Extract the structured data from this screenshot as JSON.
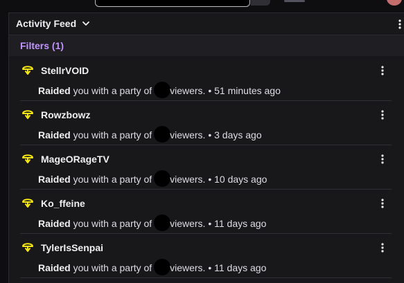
{
  "panel": {
    "title": "Activity Feed",
    "filters_label": "Filters (1)"
  },
  "colors": {
    "accent": "#bf94ff",
    "raid_icon": "#f5e614",
    "background": "#18181b"
  },
  "feed": {
    "items": [
      {
        "name": "StellrVOID",
        "action": "Raided",
        "text_before": " you with a party of ",
        "text_after": "viewers.",
        "time": " • 51 minutes ago"
      },
      {
        "name": "Rowzbowz",
        "action": "Raided",
        "text_before": " you with a party of ",
        "text_after": "viewers.",
        "time": " • 3 days ago"
      },
      {
        "name": "MageORageTV",
        "action": "Raided",
        "text_before": " you with a party of ",
        "text_after": "viewers.",
        "time": " • 10 days ago"
      },
      {
        "name": "Ko_ffeine",
        "action": "Raided",
        "text_before": " you with a party of ",
        "text_after": "viewers.",
        "time": " • 11 days ago"
      },
      {
        "name": "TylerIsSenpai",
        "action": "Raided",
        "text_before": " you with a party of ",
        "text_after": "viewers.",
        "time": " • 11 days ago"
      }
    ]
  }
}
